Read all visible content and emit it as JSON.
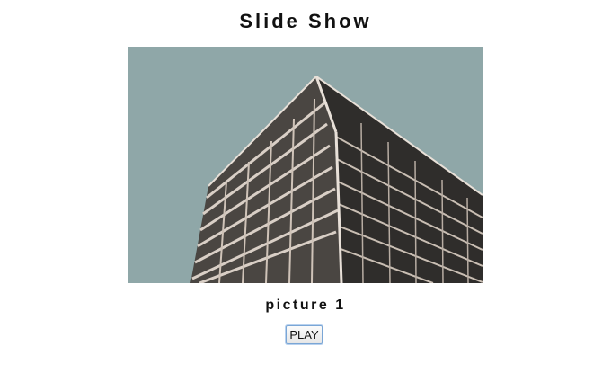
{
  "slideshow": {
    "title": "Slide Show",
    "caption": "picture 1",
    "play_label": "PLAY"
  },
  "colors": {
    "sky": "#8fa7a8",
    "building_face_left": "#4a4642",
    "building_face_right": "#2f2d2b",
    "slab_light": "#d9cfc6",
    "button_focus_border": "#7aa6d6"
  }
}
